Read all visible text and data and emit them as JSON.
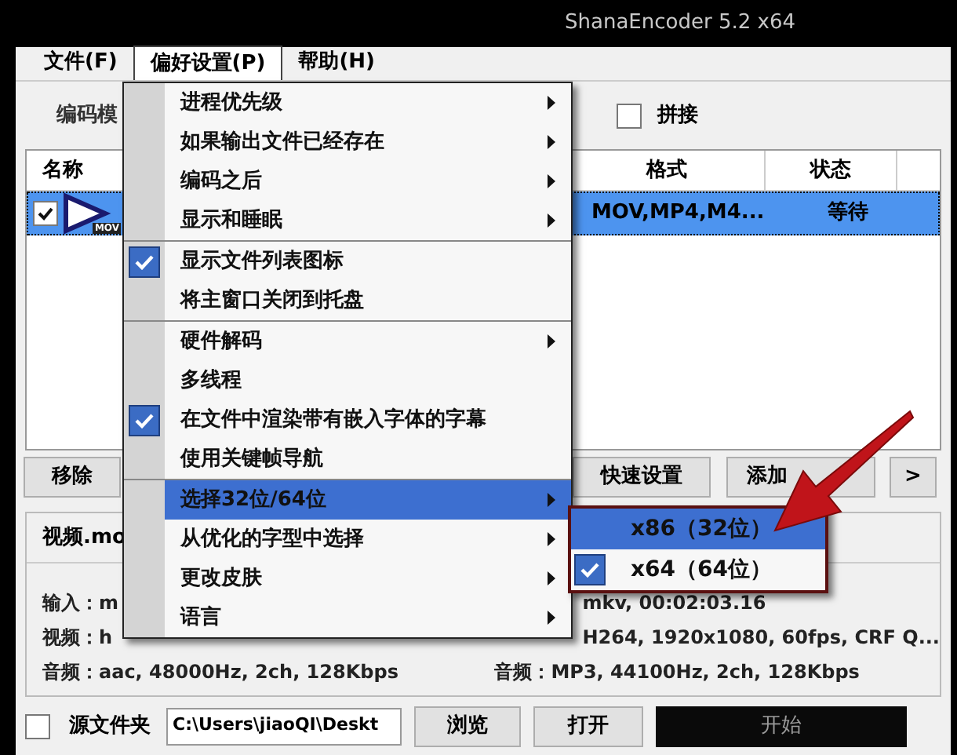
{
  "window": {
    "title": "ShanaEncoder 5.2 x64"
  },
  "menu_bar": [
    {
      "label": "文件(F)",
      "selected": false
    },
    {
      "label": "偏好设置(P)",
      "selected": true
    },
    {
      "label": "帮助(H)",
      "selected": false
    }
  ],
  "toolbar": {
    "tab_label": "编码模",
    "join": {
      "label": "拼接",
      "checked": false
    }
  },
  "table": {
    "columns": [
      "名称",
      "格式",
      "状态"
    ],
    "rows": [
      {
        "checked": true,
        "selected": true,
        "icon_badge": "MOV",
        "format": "MOV,MP4,M4...",
        "status": "等待"
      }
    ]
  },
  "buttons": [
    "移除",
    "快速设置",
    "添加",
    ">"
  ],
  "info": {
    "title": "视频.mo",
    "left_lines": [
      "输入：m",
      "视频：h",
      "音频：aac, 48000Hz, 2ch, 128Kbps"
    ],
    "right_lines": [
      "mkv, 00:02:03.16",
      "H264, 1920x1080, 60fps, CRF Q...",
      "音频：MP3, 44100Hz, 2ch, 128Kbps"
    ]
  },
  "bottom": {
    "source_folder": {
      "label": "源文件夹",
      "checked": false
    },
    "path": "C:\\Users\\jiaoQI\\Deskt",
    "buttons": [
      "浏览",
      "打开",
      "开始"
    ]
  },
  "preferences_menu": [
    [
      {
        "label": "进程优先级",
        "kind": "submenu",
        "checked": false,
        "selected": false
      },
      {
        "label": "如果输出文件已经存在",
        "kind": "submenu",
        "checked": false,
        "selected": false
      },
      {
        "label": "编码之后",
        "kind": "submenu",
        "checked": false,
        "selected": false
      },
      {
        "label": "显示和睡眠",
        "kind": "submenu",
        "checked": false,
        "selected": false
      }
    ],
    [
      {
        "label": "显示文件列表图标",
        "kind": "plain",
        "checked": true,
        "selected": false
      },
      {
        "label": "将主窗口关闭到托盘",
        "kind": "plain",
        "checked": false,
        "selected": false
      }
    ],
    [
      {
        "label": "硬件解码",
        "kind": "submenu",
        "checked": false,
        "selected": false
      },
      {
        "label": "多线程",
        "kind": "plain",
        "checked": false,
        "selected": false
      },
      {
        "label": "在文件中渲染带有嵌入字体的字幕",
        "kind": "plain",
        "checked": true,
        "selected": false
      },
      {
        "label": "使用关键帧导航",
        "kind": "plain",
        "checked": false,
        "selected": false
      }
    ],
    [
      {
        "label": "选择32位/64位",
        "kind": "submenu",
        "checked": false,
        "selected": true
      },
      {
        "label": "从优化的字型中选择",
        "kind": "submenu",
        "checked": false,
        "selected": false
      },
      {
        "label": "更改皮肤",
        "kind": "submenu",
        "checked": false,
        "selected": false
      },
      {
        "label": "语言",
        "kind": "submenu",
        "checked": false,
        "selected": false
      }
    ]
  ],
  "submenu": [
    {
      "label": "x86（32位）",
      "checked": false,
      "selected": true
    },
    {
      "label": "x64（64位）",
      "checked": true,
      "selected": false
    }
  ]
}
